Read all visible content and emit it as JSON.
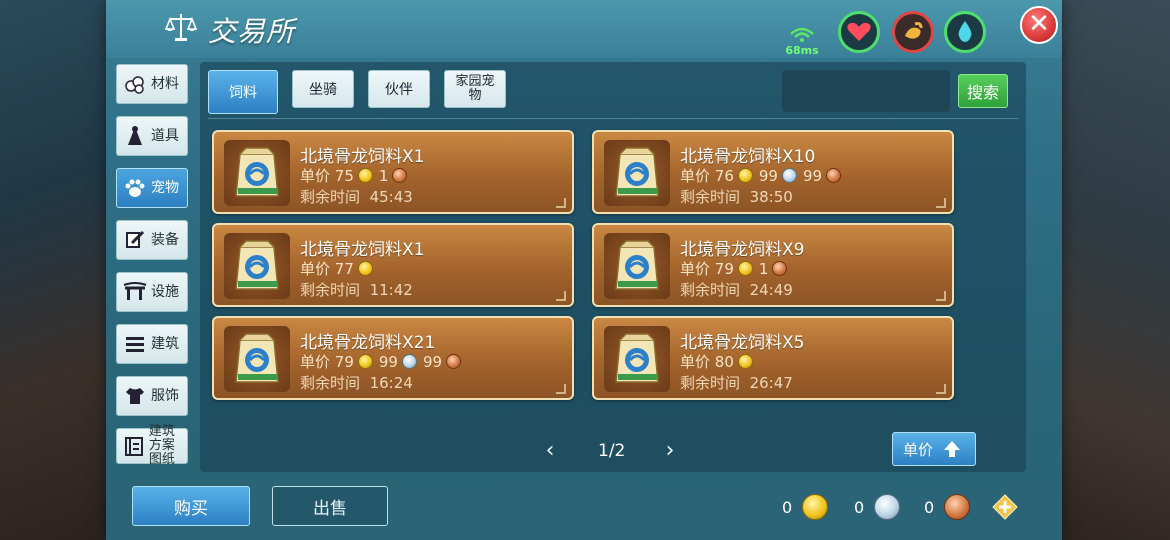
{
  "header": {
    "title": "交易所",
    "ping": "68ms"
  },
  "colors": {
    "panel": "#2f6f86",
    "accent": "#2d80c4",
    "card": "#a4642c",
    "search": "#2ea13a"
  },
  "side_nav": [
    {
      "label": "材料",
      "icon": "materials-icon"
    },
    {
      "label": "道具",
      "icon": "props-icon"
    },
    {
      "label": "宠物",
      "icon": "pet-paw-icon",
      "active": true
    },
    {
      "label": "装备",
      "icon": "equipment-icon"
    },
    {
      "label": "设施",
      "icon": "facility-icon"
    },
    {
      "label": "建筑",
      "icon": "building-icon"
    },
    {
      "label": "服饰",
      "icon": "clothing-icon"
    },
    {
      "label": "建筑方案图纸",
      "icon": "blueprint-icon"
    }
  ],
  "tabs": [
    {
      "label": "饲料",
      "active": true
    },
    {
      "label": "坐骑"
    },
    {
      "label": "伙伴"
    },
    {
      "label": "家园宠物"
    }
  ],
  "search": {
    "value": "",
    "placeholder": "",
    "button": "搜索"
  },
  "items": [
    {
      "name": "北境骨龙饲料X1",
      "price_label": "单价",
      "gold": "75",
      "silver": "",
      "copper": "1",
      "time_label": "剩余时间",
      "time": "45:43"
    },
    {
      "name": "北境骨龙饲料X10",
      "price_label": "单价",
      "gold": "76",
      "silver": "99",
      "copper": "99",
      "time_label": "剩余时间",
      "time": "38:50"
    },
    {
      "name": "北境骨龙饲料X1",
      "price_label": "单价",
      "gold": "77",
      "silver": "",
      "copper": "",
      "time_label": "剩余时间",
      "time": "11:42"
    },
    {
      "name": "北境骨龙饲料X9",
      "price_label": "单价",
      "gold": "79",
      "silver": "",
      "copper": "1",
      "time_label": "剩余时间",
      "time": "24:49"
    },
    {
      "name": "北境骨龙饲料X21",
      "price_label": "单价",
      "gold": "79",
      "silver": "99",
      "copper": "99",
      "time_label": "剩余时间",
      "time": "16:24"
    },
    {
      "name": "北境骨龙饲料X5",
      "price_label": "单价",
      "gold": "80",
      "silver": "",
      "copper": "",
      "time_label": "剩余时间",
      "time": "26:47"
    }
  ],
  "pager": {
    "text": "1/2"
  },
  "sort": {
    "label": "单价"
  },
  "footer": {
    "buy": "购买",
    "sell": "出售",
    "gold": "0",
    "silver": "0",
    "copper": "0"
  }
}
